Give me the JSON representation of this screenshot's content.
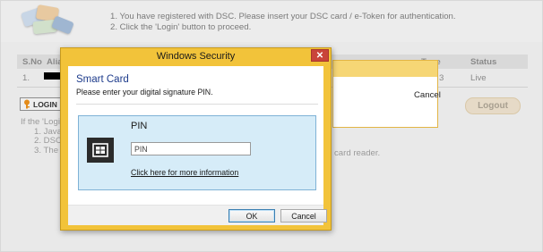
{
  "background_page": {
    "instructions": [
      "1.  You have registered with DSC. Please insert your DSC card / e-Token for authentication.",
      "2.  Click the 'Login' button to proceed."
    ],
    "table": {
      "columns": {
        "sno": "S.No",
        "alias": "Alia",
        "type": "Type",
        "status": "Status"
      },
      "row": {
        "sno": "1.",
        "type_fragment": "3",
        "status": "Live"
      }
    },
    "login_label": "LOGIN",
    "logout_label": "Logout",
    "help_intro": "If the 'Login'",
    "help_items": [
      "1.  Java",
      "2.  DSC",
      "3.  The"
    ],
    "card_reader_text": "card reader."
  },
  "background_dialog": {
    "cancel_label": "Cancel"
  },
  "security_dialog": {
    "title": "Windows Security",
    "close_glyph": "✕",
    "heading": "Smart Card",
    "subtitle": "Please enter your digital signature PIN.",
    "pin_label": "PIN",
    "pin_placeholder": "PIN",
    "more_info_link": "Click here for more information",
    "ok_label": "OK",
    "cancel_label": "Cancel"
  },
  "icons": {
    "smart_card": "smart-card-reader-icon",
    "login": "lock-key-icon",
    "dsc": "dsc-token-illustration"
  },
  "colors": {
    "dialog_frame": "#f2c33a",
    "close_button": "#c9443a",
    "heading_blue": "#1e3c8c",
    "pin_panel": "#d6ecf8",
    "logout_button": "#e6dac7"
  }
}
